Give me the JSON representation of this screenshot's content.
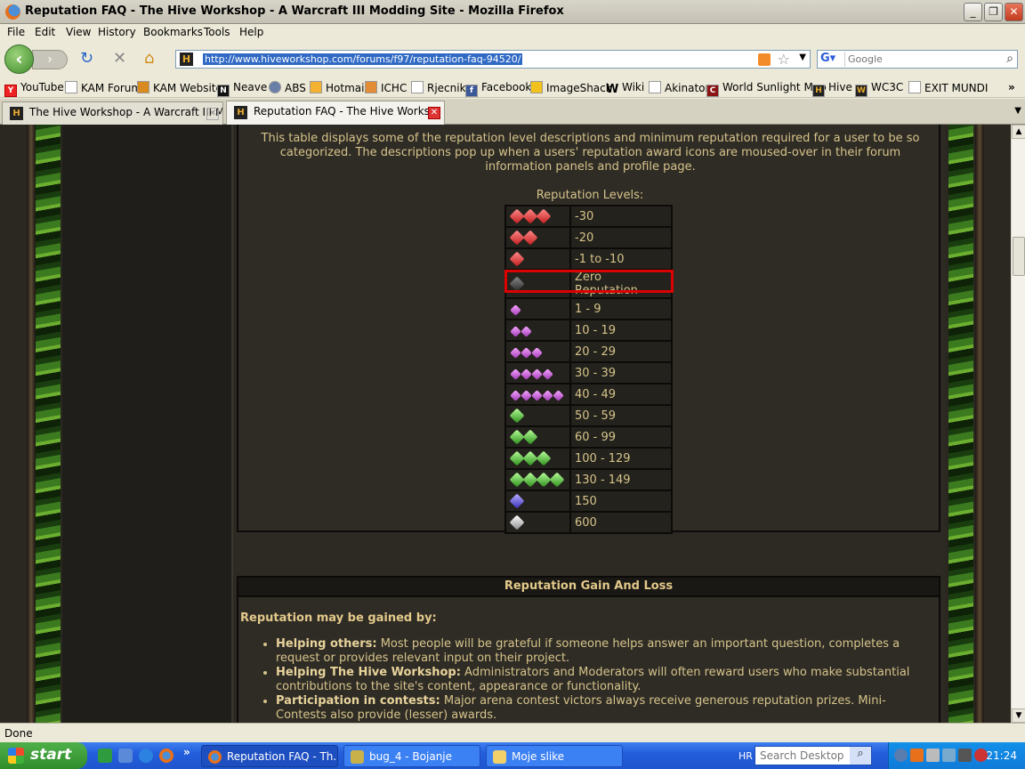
{
  "window": {
    "title": "Reputation FAQ - The Hive Workshop - A Warcraft III Modding Site - Mozilla Firefox"
  },
  "menu": [
    "File",
    "Edit",
    "View",
    "History",
    "Bookmarks",
    "Tools",
    "Help"
  ],
  "nav": {
    "url": "http://www.hiveworkshop.com/forums/f97/reputation-faq-94520/",
    "search_placeholder": "Google"
  },
  "bookmarks": [
    "YouTube",
    "KAM Forum",
    "KAM Website",
    "Neave",
    "ABS",
    "Hotmail",
    "ICHC",
    "Rjecnik",
    "Facebook",
    "ImageShack",
    "Wiki",
    "Akinator",
    "World Sunlight Map",
    "Hive",
    "WC3C",
    "EXIT MUNDI"
  ],
  "tabs": [
    {
      "label": "The Hive Workshop - A Warcraft III Mo..."
    },
    {
      "label": "Reputation FAQ - The Hive Works..."
    }
  ],
  "page": {
    "intro": "This table displays some of the reputation level descriptions and minimum reputation required for a user to be so categorized. The descriptions pop up when a users' reputation award icons are moused-over in their forum information panels and profile page.",
    "levels_label": "Reputation Levels:",
    "levels": [
      {
        "gems": "red",
        "count": 3,
        "label": "-30"
      },
      {
        "gems": "red",
        "count": 2,
        "label": "-20"
      },
      {
        "gems": "red",
        "count": 1,
        "label": "-1 to -10"
      },
      {
        "gems": "gray",
        "count": 1,
        "label": "Zero Reputation"
      },
      {
        "gems": "pink",
        "count": 1,
        "label": "1 - 9"
      },
      {
        "gems": "pink",
        "count": 2,
        "label": "10 - 19"
      },
      {
        "gems": "pink",
        "count": 3,
        "label": "20 - 29"
      },
      {
        "gems": "pink",
        "count": 4,
        "label": "30 - 39"
      },
      {
        "gems": "pink",
        "count": 5,
        "label": "40 - 49"
      },
      {
        "gems": "green",
        "count": 1,
        "label": "50 - 59"
      },
      {
        "gems": "green",
        "count": 2,
        "label": "60 - 99"
      },
      {
        "gems": "green",
        "count": 3,
        "label": "100 - 129"
      },
      {
        "gems": "green",
        "count": 4,
        "label": "130 - 149"
      },
      {
        "gems": "blue",
        "count": 1,
        "label": "150"
      },
      {
        "gems": "white",
        "count": 1,
        "label": "600"
      }
    ],
    "section_title": "Reputation Gain And Loss",
    "gain_heading": "Reputation may be gained by:",
    "gain_items": [
      {
        "title": "Helping others:",
        "text": " Most people will be grateful if someone helps answer an important question, completes a request or provides relevant input on their project."
      },
      {
        "title": "Helping The Hive Workshop:",
        "text": " Administrators and Moderators will often reward users who make substantial contributions to the site's content, appearance or functionality."
      },
      {
        "title": "Participation in contests:",
        "text": " Major arena contest victors always receive generous reputation prizes. Mini-Contests also provide (lesser) awards."
      }
    ]
  },
  "status": "Done",
  "taskbar": {
    "start": "start",
    "tasks": [
      "Reputation FAQ - Th...",
      "bug_4 - Bojanje",
      "Moje slike"
    ],
    "lang": "HR",
    "desk_search": "Search Desktop",
    "clock": "21:24"
  }
}
